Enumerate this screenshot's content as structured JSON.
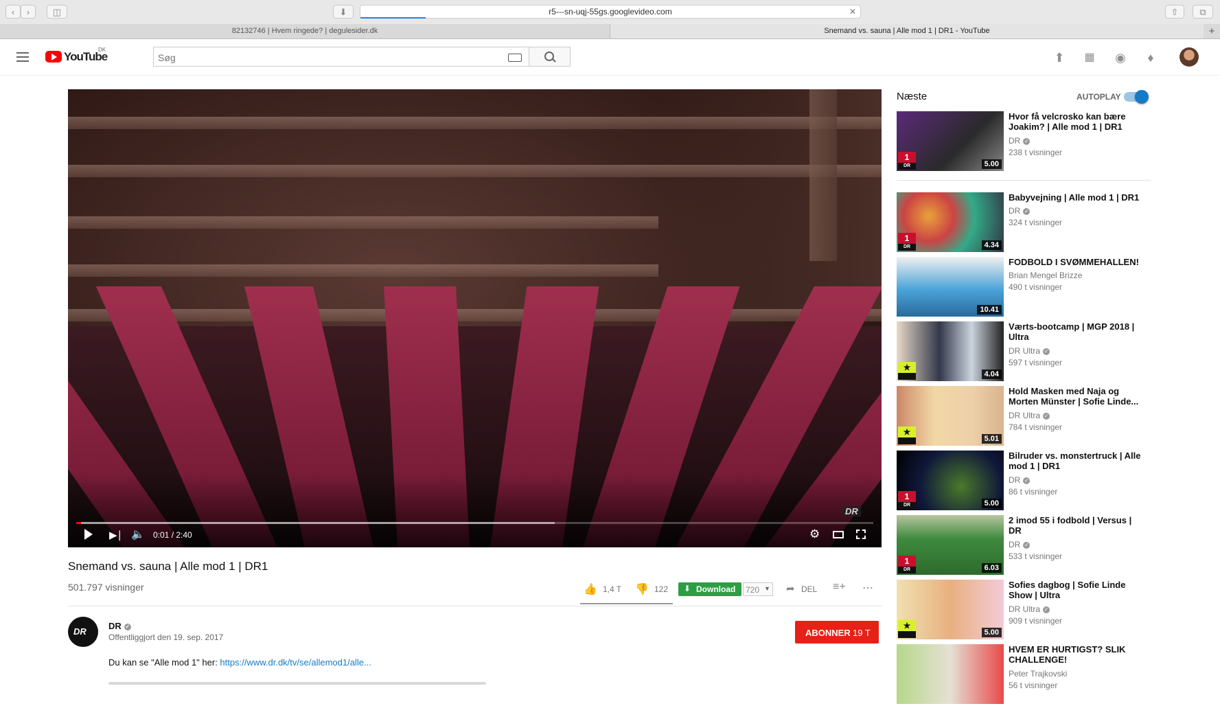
{
  "browser": {
    "url": "r5---sn-uqj-55gs.googlevideo.com",
    "load_progress": 0.13,
    "tabs": [
      {
        "label": "82132746 | Hvem ringede? | degulesider.dk"
      },
      {
        "label": "Snemand vs. sauna | Alle mod 1 | DR1 - YouTube"
      }
    ]
  },
  "header": {
    "logo_text": "YouTube",
    "logo_region": "DK",
    "search_placeholder": "Søg"
  },
  "player": {
    "watermark": "DR",
    "time": "0:01 / 2:40",
    "played_fraction": 0.006,
    "buffered_fraction": 0.6
  },
  "video": {
    "title": "Snemand vs. sauna | Alle mod 1 | DR1",
    "views": "501.797 visninger",
    "likes": "1,4 T",
    "dislikes": "122",
    "download_label": "Download",
    "quality": "720",
    "share_label": "DEL"
  },
  "channel": {
    "avatar_text": "DR",
    "name": "DR",
    "published": "Offentliggjort den 19. sep. 2017",
    "subscribe_label": "ABONNER",
    "subscriber_count": "19 T",
    "desc_prefix": "Du kan se \"Alle mod 1\" her: ",
    "desc_link": "https://www.dr.dk/tv/se/allemod1/alle..."
  },
  "sidebar": {
    "next_label": "Næste",
    "autoplay_label": "AUTOPLAY",
    "items": [
      {
        "title": "Hvor få velcrosko kan bære Joakim? | Alle mod 1 | DR1",
        "channel": "DR",
        "verified": true,
        "views": "238 t visninger",
        "duration": "5.00",
        "badge": "1"
      },
      {
        "title": "Babyvejning | Alle mod 1 | DR1",
        "channel": "DR",
        "verified": true,
        "views": "324 t visninger",
        "duration": "4.34",
        "badge": "1"
      },
      {
        "title": "FODBOLD I SVØMMEHALLEN!",
        "channel": "Brian Mengel Brizze",
        "verified": false,
        "views": "490 t visninger",
        "duration": "10.41",
        "badge": ""
      },
      {
        "title": "Værts-bootcamp | MGP 2018 | Ultra",
        "channel": "DR Ultra",
        "verified": true,
        "views": "597 t visninger",
        "duration": "4.04",
        "badge": "U"
      },
      {
        "title": "Hold Masken med Naja og Morten Münster | Sofie Linde...",
        "channel": "DR Ultra",
        "verified": true,
        "views": "784 t visninger",
        "duration": "5.01",
        "badge": "U"
      },
      {
        "title": "Bilruder vs. monstertruck | Alle mod 1 | DR1",
        "channel": "DR",
        "verified": true,
        "views": "86 t visninger",
        "duration": "5.00",
        "badge": "1"
      },
      {
        "title": "2 imod 55 i fodbold | Versus | DR",
        "channel": "DR",
        "verified": true,
        "views": "533 t visninger",
        "duration": "6.03",
        "badge": "1"
      },
      {
        "title": "Sofies dagbog | Sofie Linde Show | Ultra",
        "channel": "DR Ultra",
        "verified": true,
        "views": "909 t visninger",
        "duration": "5.00",
        "badge": "U"
      },
      {
        "title": "HVEM ER HURTIGST? SLIK CHALLENGE!",
        "channel": "Peter Trajkovski",
        "verified": false,
        "views": "56 t visninger",
        "duration": "",
        "badge": ""
      }
    ]
  },
  "colors": {
    "brand_red": "#ff0000",
    "subscribe_red": "#e62117",
    "download_green": "#2e9e44",
    "link_blue": "#167ac6",
    "toggle_blue": "#167ac6"
  }
}
